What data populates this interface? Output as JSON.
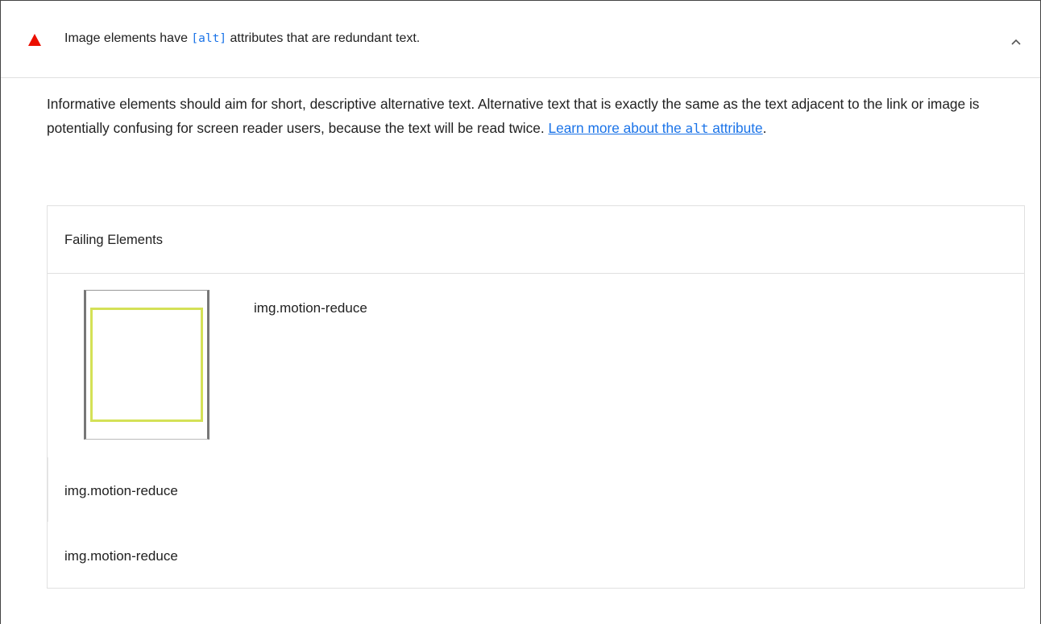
{
  "audit": {
    "title_before": "Image elements have ",
    "title_code": "[alt]",
    "title_after": " attributes that are redundant text.",
    "description": "Informative elements should aim for short, descriptive alternative text. Alternative text that is exactly the same as the text adjacent to the link or image is potentially confusing for screen reader users, because the text will be read twice. ",
    "link_before": "Learn more about the ",
    "link_code": "alt",
    "link_after": " attribute",
    "description_end": "."
  },
  "table": {
    "header": "Failing Elements",
    "rows": [
      {
        "label": "img.motion-reduce"
      },
      {
        "label": "img.motion-reduce"
      },
      {
        "label": "img.motion-reduce"
      }
    ]
  },
  "colors": {
    "fail": "#eb0f00",
    "link": "#1a73e8",
    "highlight": "#d4e157"
  },
  "icons": {
    "status": "warning-triangle-icon",
    "toggle": "chevron-up-icon"
  }
}
